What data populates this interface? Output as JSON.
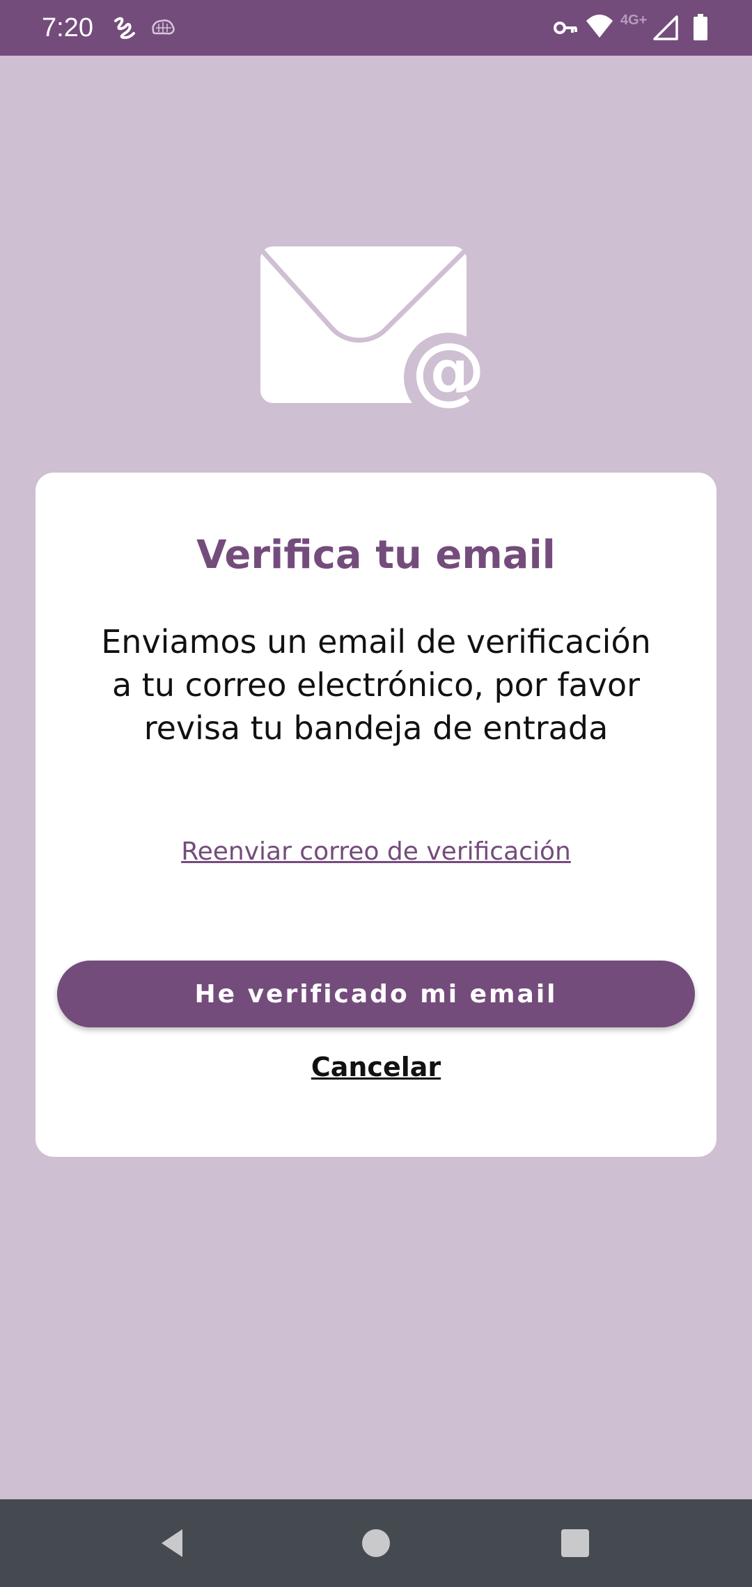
{
  "status_bar": {
    "time": "7:20",
    "network_label": "4G+",
    "background_color": "#744c7c",
    "icons_left": [
      "scribble-icon",
      "brain-icon"
    ],
    "icons_right": [
      "vpn-key-icon",
      "wifi-icon",
      "cell-signal-icon",
      "battery-icon"
    ]
  },
  "hero": {
    "icon": "envelope-at-icon"
  },
  "card": {
    "title": "Verifica tu email",
    "body": "Enviamos un email de verificación a tu correo electrónico, por favor revisa tu bandeja de entrada",
    "resend_link": "Reenviar correo de verificación",
    "primary_button": "He verificado mi email",
    "cancel_link": "Cancelar"
  },
  "nav_bar": {
    "icons": [
      "back-icon",
      "home-icon",
      "recents-icon"
    ]
  },
  "colors": {
    "background": "#cebfd2",
    "accent": "#744c7c",
    "card": "#ffffff",
    "nav_bar": "#454a50"
  }
}
